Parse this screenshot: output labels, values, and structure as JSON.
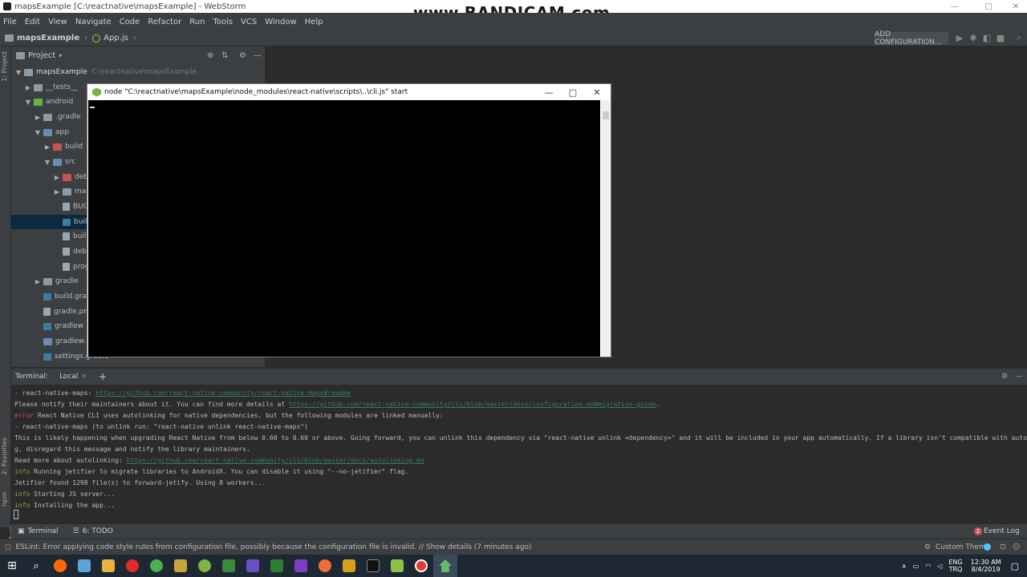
{
  "window": {
    "title": "mapsExample [C:\\reactnative\\mapsExample] - WebStorm",
    "minimize": "—",
    "maximize": "□",
    "close": "✕"
  },
  "watermark": "www.BANDICAM.com",
  "menu": [
    "File",
    "Edit",
    "View",
    "Navigate",
    "Code",
    "Refactor",
    "Run",
    "Tools",
    "VCS",
    "Window",
    "Help"
  ],
  "nav": {
    "project": "mapsExample",
    "file": "App.js",
    "run_config": "ADD CONFIGURATION..."
  },
  "left_strip": {
    "project_tab": "1: Project",
    "favorites_tab": "2: Favorites",
    "npm_tab": "npm",
    "structure_tab": "Z: Structure"
  },
  "project_panel": {
    "title": "Project",
    "tree": [
      {
        "label": "mapsExample",
        "path": "C:\\reactnative\\mapsExample"
      },
      {
        "label": "__tests__"
      },
      {
        "label": "android"
      },
      {
        "label": ".gradle"
      },
      {
        "label": "app"
      },
      {
        "label": "build"
      },
      {
        "label": "src"
      },
      {
        "label": "debug"
      },
      {
        "label": "main"
      },
      {
        "label": "BUCK"
      },
      {
        "label": "build.gradle"
      },
      {
        "label": "build_defs"
      },
      {
        "label": "debug.key"
      },
      {
        "label": "proguard-"
      },
      {
        "label": "gradle"
      },
      {
        "label": "build.gradle"
      },
      {
        "label": "gradle.properties"
      },
      {
        "label": "gradlew"
      },
      {
        "label": "gradlew.bat"
      },
      {
        "label": "settings.gradle"
      }
    ]
  },
  "cmd_window": {
    "title": "node  \"C:\\reactnative\\mapsExample\\node_modules\\react-native\\scripts\\..\\cli.js\" start",
    "minimize": "—",
    "maximize": "□",
    "close": "✕"
  },
  "terminal": {
    "label": "Terminal:",
    "tab": "Local",
    "tab_close": "×",
    "add": "+",
    "lines": [
      {
        "prefix": "",
        "text": "  - react-native-maps: ",
        "link": "https://github.com/react-native-community/react-native-maps#readme"
      },
      {
        "prefix": "",
        "text": "Please notify their maintainers about it. You can find more details at ",
        "link": "https://github.com/react-native-community/cli/blob/master/docs/configuration.md#migration-guide",
        "suffix": "."
      },
      {
        "prefix": "error",
        "text": " React Native CLI uses autolinking for native dependencies, but the following modules are linked manually:"
      },
      {
        "prefix": "",
        "text": "  - react-native-maps (to unlink run: \"react-native unlink react-native-maps\")"
      },
      {
        "prefix": "",
        "text": "This is likely happening when upgrading React Native from below 0.60 to 0.60 or above. Going forward, you can unlink this dependency via \"react-native unlink <dependency>\" and it will be included in your app automatically. If a library isn't compatible with autolinkin"
      },
      {
        "prefix": "",
        "text": "g, disregard this message and notify the library maintainers."
      },
      {
        "prefix": "",
        "text": "Read more about autolinking: ",
        "link": "https://github.com/react-native-community/cli/blob/master/docs/autolinking.md"
      },
      {
        "prefix": "info",
        "text": " Running jetifier to migrate libraries to AndroidX. You can disable it using \"--no-jetifier\" flag."
      },
      {
        "prefix": "",
        "text": "Jetifier found 1298 file(s) to forward-jetify. Using 8 workers..."
      },
      {
        "prefix": "info",
        "text": " Starting JS server..."
      },
      {
        "prefix": "info",
        "text": " Installing the app..."
      }
    ]
  },
  "tool_tabs": {
    "terminal": "Terminal",
    "todo": "6: TODO",
    "event_log": "Event Log",
    "event_count": "2"
  },
  "status": {
    "message": "ESLint: Error applying code style rules from configuration file, possibly because the configuration file is invalid. // Show details (7 minutes ago)",
    "theme": "Custom Theme"
  },
  "tray": {
    "lang": "ENG",
    "layout": "TRQ",
    "time": "12:30 AM",
    "date": "8/4/2019"
  }
}
